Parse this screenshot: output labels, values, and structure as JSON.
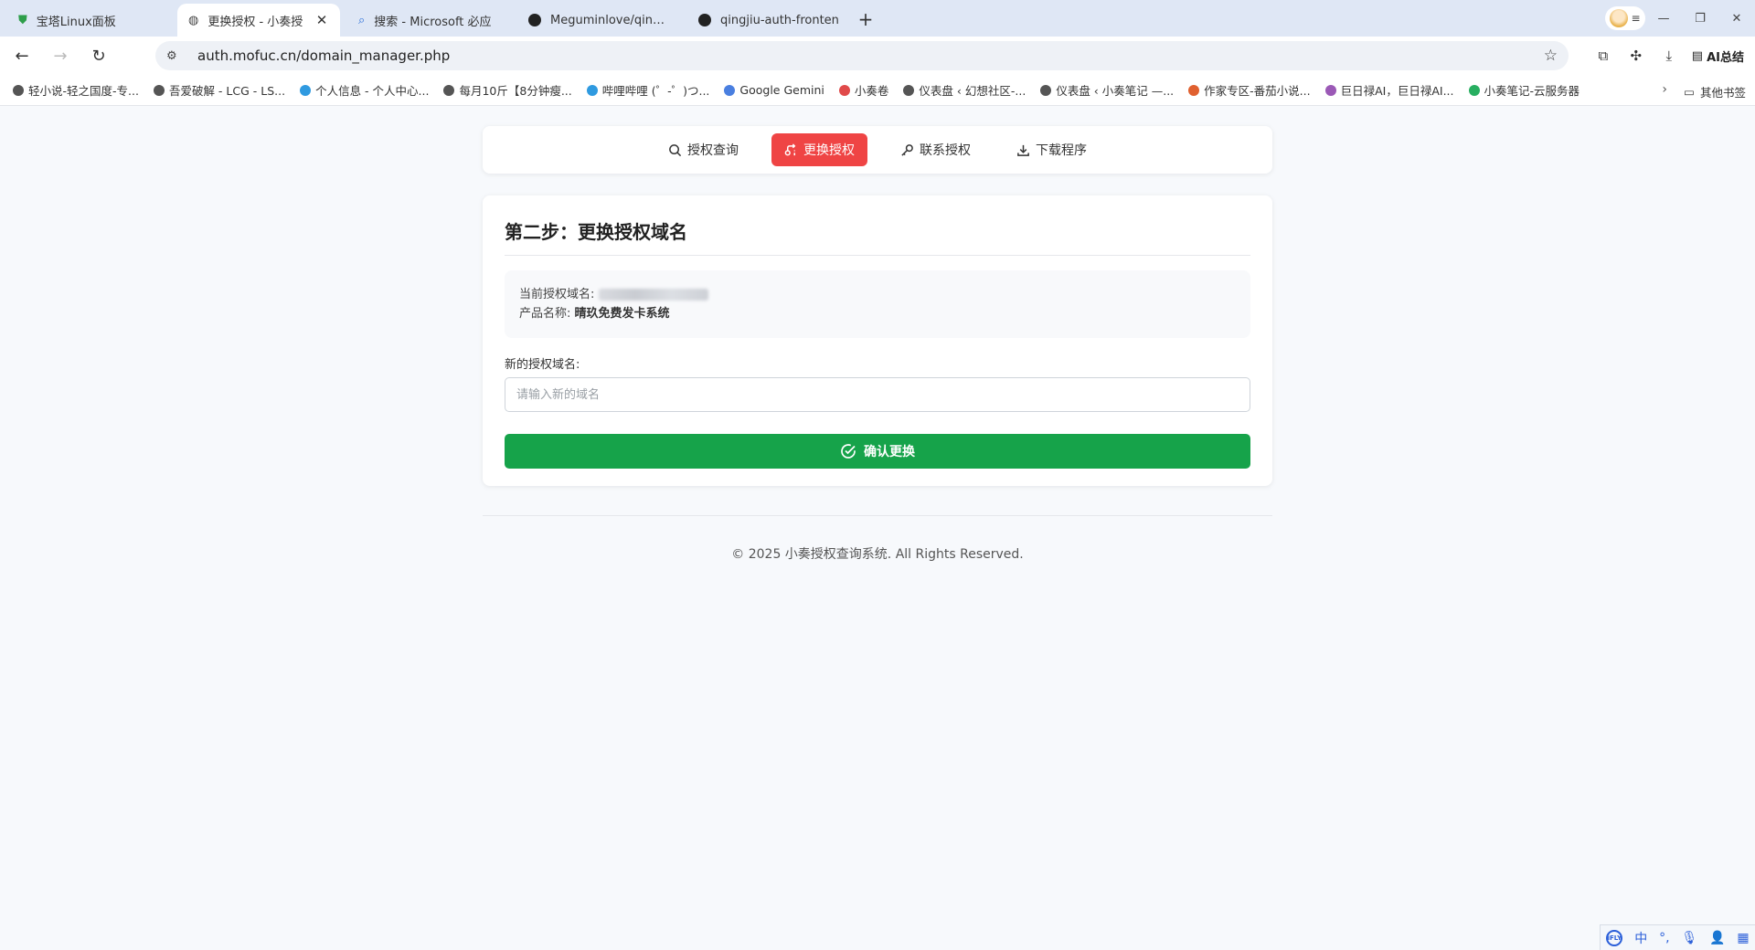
{
  "browser": {
    "tabs": [
      {
        "title": "宝塔Linux面板",
        "icon": "shield-icon",
        "active": false
      },
      {
        "title": "更换授权 - 小奏授",
        "icon": "globe-icon",
        "active": true
      },
      {
        "title": "搜索 - Microsoft 必应",
        "icon": "search-icon",
        "active": false
      },
      {
        "title": "Meguminlove/qingjiu",
        "icon": "github-icon",
        "active": false
      },
      {
        "title": "qingjiu-auth-fronten",
        "icon": "github-icon",
        "active": false
      }
    ],
    "new_tab": "+",
    "url": "auth.mofuc.cn/domain_manager.php",
    "ai_label": "AI总结",
    "bookmarks": [
      {
        "label": "轻小说-轻之国度-专...",
        "color": "#555555"
      },
      {
        "label": "吾爱破解 - LCG - LS...",
        "color": "#555555"
      },
      {
        "label": "个人信息 - 个人中心...",
        "color": "#2f9ae0"
      },
      {
        "label": "每月10斤【8分钟瘦...",
        "color": "#555555"
      },
      {
        "label": "哔哩哔哩 (゜-゜)つ...",
        "color": "#2f9ae0"
      },
      {
        "label": "Google Gemini",
        "color": "#4a7fe0"
      },
      {
        "label": "小奏卷",
        "color": "#e04a4a"
      },
      {
        "label": "仪表盘 ‹ 幻想社区-...",
        "color": "#555555"
      },
      {
        "label": "仪表盘 ‹ 小奏笔记 —...",
        "color": "#555555"
      },
      {
        "label": "作家专区-番茄小说...",
        "color": "#e0602f"
      },
      {
        "label": "巨日禄AI，巨日禄AI...",
        "color": "#9b59b6"
      },
      {
        "label": "小奏笔记-云服务器",
        "color": "#27ae60"
      }
    ],
    "other_bookmarks": "其他书签"
  },
  "nav": {
    "items": [
      {
        "label": "授权查询",
        "icon": "search-icon",
        "active": false
      },
      {
        "label": "更换授权",
        "icon": "exchange-icon",
        "active": true
      },
      {
        "label": "联系授权",
        "icon": "key-icon",
        "active": false
      },
      {
        "label": "下载程序",
        "icon": "download-icon",
        "active": false
      }
    ]
  },
  "main": {
    "step_title": "第二步：更换授权域名",
    "current_domain_label": "当前授权域名:",
    "product_label": "产品名称:",
    "product_name": "晴玖免费发卡系统",
    "new_domain_label": "新的授权域名:",
    "new_domain_placeholder": "请输入新的域名",
    "new_domain_value": "",
    "confirm_label": "确认更换"
  },
  "footer": {
    "text": "© 2025 小奏授权查询系统. All Rights Reserved."
  },
  "ime": {
    "logo": "iFLY",
    "mode": "中"
  },
  "colors": {
    "accent_red": "#ef4444",
    "confirm_green": "#16a34a"
  }
}
